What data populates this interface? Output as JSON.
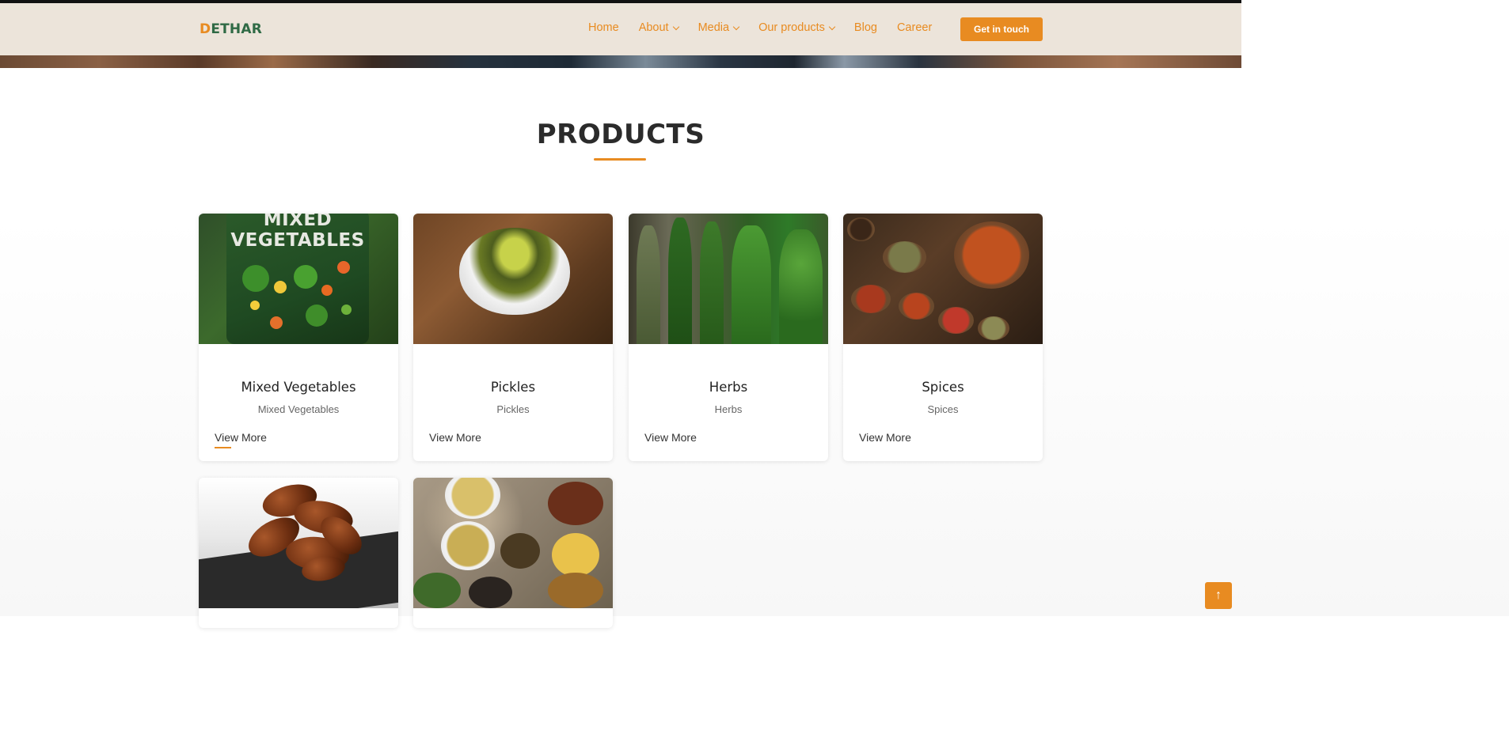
{
  "brand": {
    "logo_first": "D",
    "logo_rest": "ETHAR"
  },
  "nav": {
    "items": [
      {
        "label": "Home",
        "dropdown": false
      },
      {
        "label": "About",
        "dropdown": true
      },
      {
        "label": "Media",
        "dropdown": true
      },
      {
        "label": "Our products",
        "dropdown": true
      },
      {
        "label": "Blog",
        "dropdown": false
      },
      {
        "label": "Career",
        "dropdown": false
      }
    ],
    "cta_label": "Get in touch"
  },
  "section": {
    "title": "PRODUCTS"
  },
  "products": [
    {
      "name": "Mixed Vegetables",
      "subtitle": "Mixed Vegetables",
      "link": "View More",
      "image_text": "MIXED VEGETABLES"
    },
    {
      "name": "Pickles",
      "subtitle": "Pickles",
      "link": "View More"
    },
    {
      "name": "Herbs",
      "subtitle": "Herbs",
      "link": "View More"
    },
    {
      "name": "Spices",
      "subtitle": "Spices",
      "link": "View More"
    }
  ],
  "theme": {
    "accent": "#e88b21",
    "brand_green": "#2f6a45",
    "header_bg": "#ece4da"
  },
  "scroll_top": {
    "icon": "arrow-up-icon",
    "glyph": "↑"
  }
}
